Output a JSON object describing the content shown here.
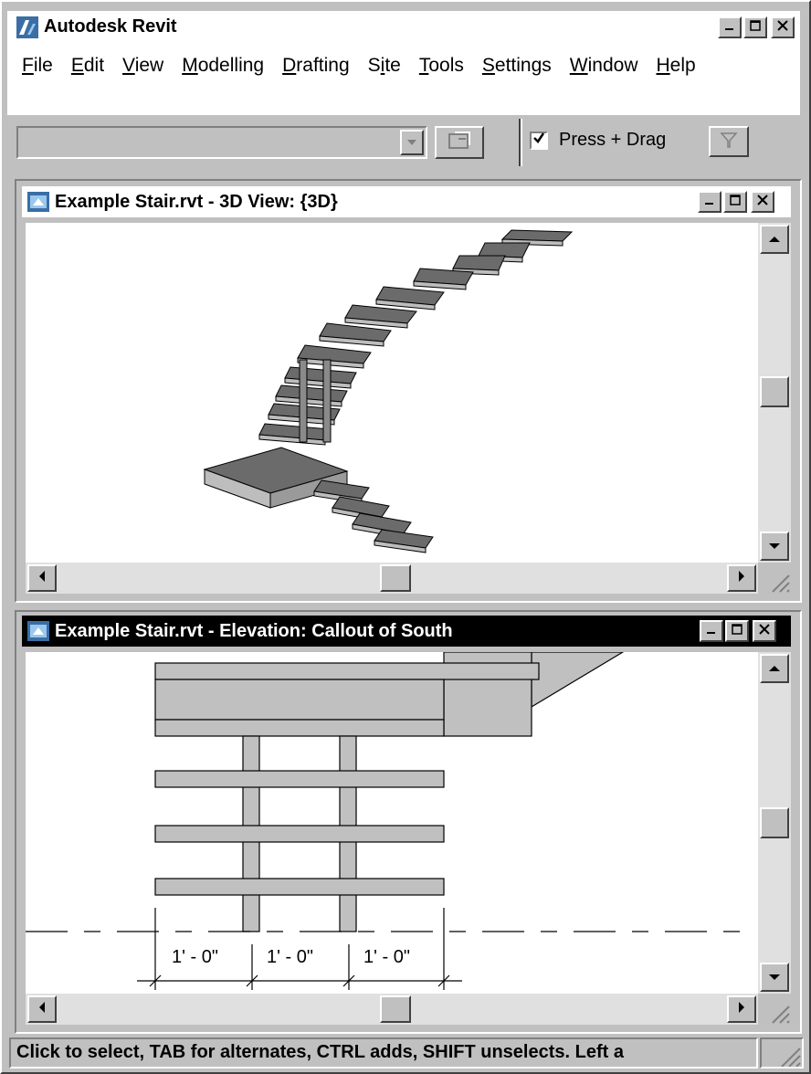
{
  "app": {
    "title": "Autodesk Revit"
  },
  "menu": [
    {
      "label": "File",
      "accel": "F",
      "rest": "ile"
    },
    {
      "label": "Edit",
      "accel": "E",
      "rest": "dit"
    },
    {
      "label": "View",
      "accel": "V",
      "rest": "iew"
    },
    {
      "label": "Modelling",
      "accel": "M",
      "rest": "odelling"
    },
    {
      "label": "Drafting",
      "accel": "D",
      "rest": "rafting"
    },
    {
      "label": "Site",
      "accel": "S",
      "pre": "S",
      "accel2": "i",
      "rest2": "te"
    },
    {
      "label": "Tools",
      "accel": "T",
      "rest": "ools"
    },
    {
      "label": "Settings",
      "accel": "S",
      "rest": "ettings"
    },
    {
      "label": "Window",
      "accel": "W",
      "rest": "indow"
    },
    {
      "label": "Help",
      "accel": "H",
      "rest": "elp"
    }
  ],
  "toolbar": {
    "type_selector_value": "",
    "press_drag_label": "Press + Drag",
    "press_drag_checked": true
  },
  "view1": {
    "title": "Example Stair.rvt - 3D View: {3D}"
  },
  "view2": {
    "title": "Example Stair.rvt - Elevation: Callout of South"
  },
  "dimensions": [
    "1' - 0\"",
    "1' - 0\"",
    "1' - 0\""
  ],
  "status": {
    "text": "Click to select, TAB for alternates, CTRL adds, SHIFT unselects. Left a"
  },
  "colors": {
    "active_title": "#000000",
    "inactive_title": "#ffffff",
    "tread_dark": "#6b6b6b",
    "elev_fill": "#c0c0c0"
  }
}
